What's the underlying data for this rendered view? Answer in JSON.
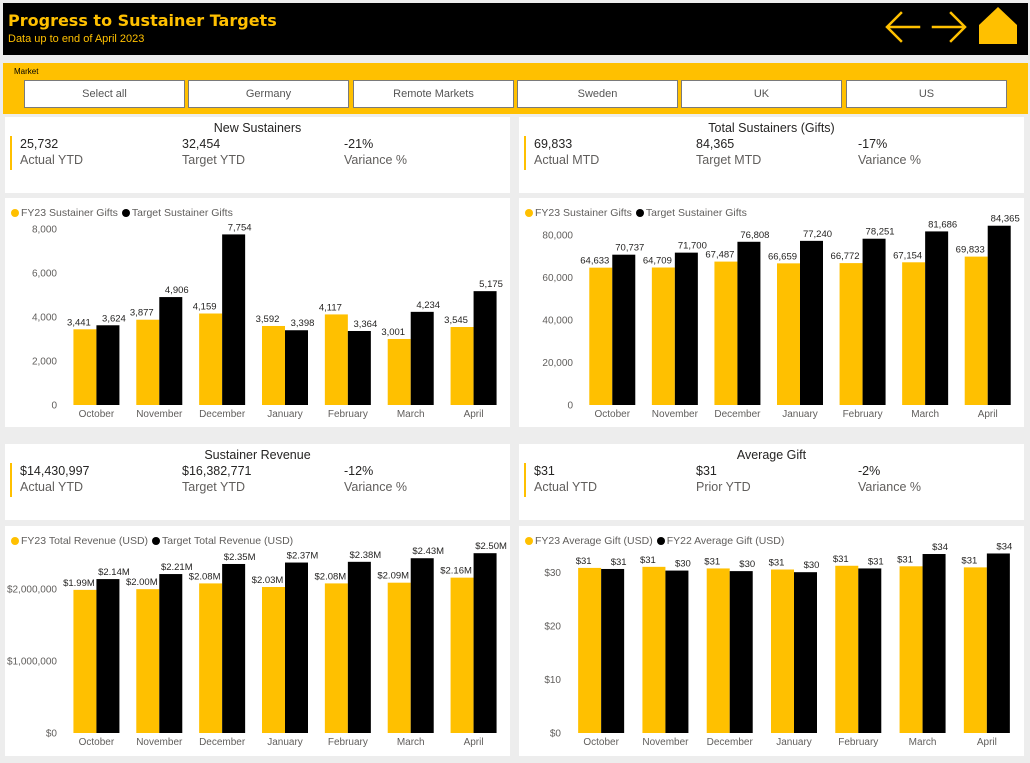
{
  "header": {
    "title": "Progress to Sustainer Targets",
    "subtitle": "Data up to end of April 2023"
  },
  "nav": {
    "back_icon": "arrow-left-icon",
    "forward_icon": "arrow-right-icon",
    "home_icon": "home-icon"
  },
  "colors": {
    "accent": "#FFC000",
    "dark": "#000000"
  },
  "slicer": {
    "label": "Market",
    "options": [
      "Select all",
      "Germany",
      "Remote Markets",
      "Sweden",
      "UK",
      "US"
    ]
  },
  "cards": {
    "new_sustainers": {
      "title": "New Sustainers",
      "kpis": [
        {
          "value": "25,732",
          "label": "Actual YTD"
        },
        {
          "value": "32,454",
          "label": "Target YTD"
        },
        {
          "value": "-21%",
          "label": "Variance %"
        }
      ]
    },
    "total_sustainers": {
      "title": "Total Sustainers (Gifts)",
      "kpis": [
        {
          "value": "69,833",
          "label": "Actual MTD"
        },
        {
          "value": "84,365",
          "label": "Target MTD"
        },
        {
          "value": "-17%",
          "label": "Variance %"
        }
      ]
    },
    "sustainer_revenue": {
      "title": "Sustainer Revenue",
      "kpis": [
        {
          "value": "$14,430,997",
          "label": "Actual YTD"
        },
        {
          "value": "$16,382,771",
          "label": "Target YTD"
        },
        {
          "value": "-12%",
          "label": "Variance %"
        }
      ]
    },
    "average_gift": {
      "title": "Average Gift",
      "kpis": [
        {
          "value": "$31",
          "label": "Actual YTD"
        },
        {
          "value": "$31",
          "label": "Prior YTD"
        },
        {
          "value": "-2%",
          "label": "Variance %"
        }
      ]
    }
  },
  "chart_data": [
    {
      "type": "bar",
      "categories": [
        "October",
        "November",
        "December",
        "January",
        "February",
        "March",
        "April"
      ],
      "series": [
        {
          "name": "FY23 Sustainer Gifts",
          "color": "#FFC000",
          "values": [
            3441,
            3877,
            4159,
            3592,
            4117,
            3001,
            3545
          ],
          "labels": [
            "3,441",
            "3,877",
            "4,159",
            "3,592",
            "4,117",
            "3,001",
            "3,545"
          ]
        },
        {
          "name": "Target Sustainer Gifts",
          "color": "#000000",
          "values": [
            3624,
            4906,
            7754,
            3398,
            3364,
            4234,
            5175
          ],
          "labels": [
            "3,624",
            "4,906",
            "7,754",
            "3,398",
            "3,364",
            "4,234",
            "5,175"
          ]
        }
      ],
      "ylim": [
        0,
        8500
      ],
      "yticks": [
        0,
        2000,
        4000,
        6000,
        8000
      ],
      "ytick_labels": [
        "0",
        "2,000",
        "4,000",
        "6,000",
        "8,000"
      ]
    },
    {
      "type": "bar",
      "categories": [
        "October",
        "November",
        "December",
        "January",
        "February",
        "March",
        "April"
      ],
      "series": [
        {
          "name": "FY23 Sustainer Gifts",
          "color": "#FFC000",
          "values": [
            64633,
            64709,
            67487,
            66659,
            66772,
            67154,
            69833
          ],
          "labels": [
            "64,633",
            "64,709",
            "67,487",
            "66,659",
            "66,772",
            "67,154",
            "69,833"
          ]
        },
        {
          "name": "Target Sustainer Gifts",
          "color": "#000000",
          "values": [
            70737,
            71700,
            76808,
            77240,
            78251,
            81686,
            84365
          ],
          "labels": [
            "70,737",
            "71,700",
            "76,808",
            "77,240",
            "78,251",
            "81,686",
            "84,365"
          ]
        }
      ],
      "ylim": [
        0,
        88000
      ],
      "yticks": [
        0,
        20000,
        40000,
        60000,
        80000
      ],
      "ytick_labels": [
        "0",
        "20,000",
        "40,000",
        "60,000",
        "80,000"
      ]
    },
    {
      "type": "bar",
      "categories": [
        "October",
        "November",
        "December",
        "January",
        "February",
        "March",
        "April"
      ],
      "series": [
        {
          "name": "FY23 Total Revenue (USD)",
          "color": "#FFC000",
          "values": [
            1990000,
            2000000,
            2080000,
            2030000,
            2080000,
            2090000,
            2160000
          ],
          "labels": [
            "$1.99M",
            "$2.00M",
            "$2.08M",
            "$2.03M",
            "$2.08M",
            "$2.09M",
            "$2.16M"
          ]
        },
        {
          "name": "Target Total Revenue (USD)",
          "color": "#000000",
          "values": [
            2140000,
            2210000,
            2350000,
            2370000,
            2380000,
            2430000,
            2500000
          ],
          "labels": [
            "$2.14M",
            "$2.21M",
            "$2.35M",
            "$2.37M",
            "$2.38M",
            "$2.43M",
            "$2.50M"
          ]
        }
      ],
      "ylim": [
        0,
        2600000
      ],
      "yticks": [
        0,
        1000000,
        2000000
      ],
      "ytick_labels": [
        "$0",
        "$1,000,000",
        "$2,000,000"
      ]
    },
    {
      "type": "bar",
      "categories": [
        "October",
        "November",
        "December",
        "January",
        "February",
        "March",
        "April"
      ],
      "series": [
        {
          "name": "FY23 Average Gift (USD)",
          "color": "#FFC000",
          "values": [
            30.9,
            31.1,
            30.8,
            30.6,
            31.3,
            31.2,
            31.0
          ],
          "labels": [
            "$31",
            "$31",
            "$31",
            "$31",
            "$31",
            "$31",
            "$31"
          ]
        },
        {
          "name": "FY22 Average Gift (USD)",
          "color": "#000000",
          "values": [
            30.7,
            30.4,
            30.3,
            30.1,
            30.8,
            33.5,
            33.6
          ],
          "labels": [
            "$31",
            "$30",
            "$30",
            "$30",
            "$31",
            "$34",
            "$34"
          ]
        }
      ],
      "ylim": [
        0,
        35
      ],
      "yticks": [
        0,
        10,
        20,
        30
      ],
      "ytick_labels": [
        "$0",
        "$10",
        "$20",
        "$30"
      ]
    }
  ]
}
